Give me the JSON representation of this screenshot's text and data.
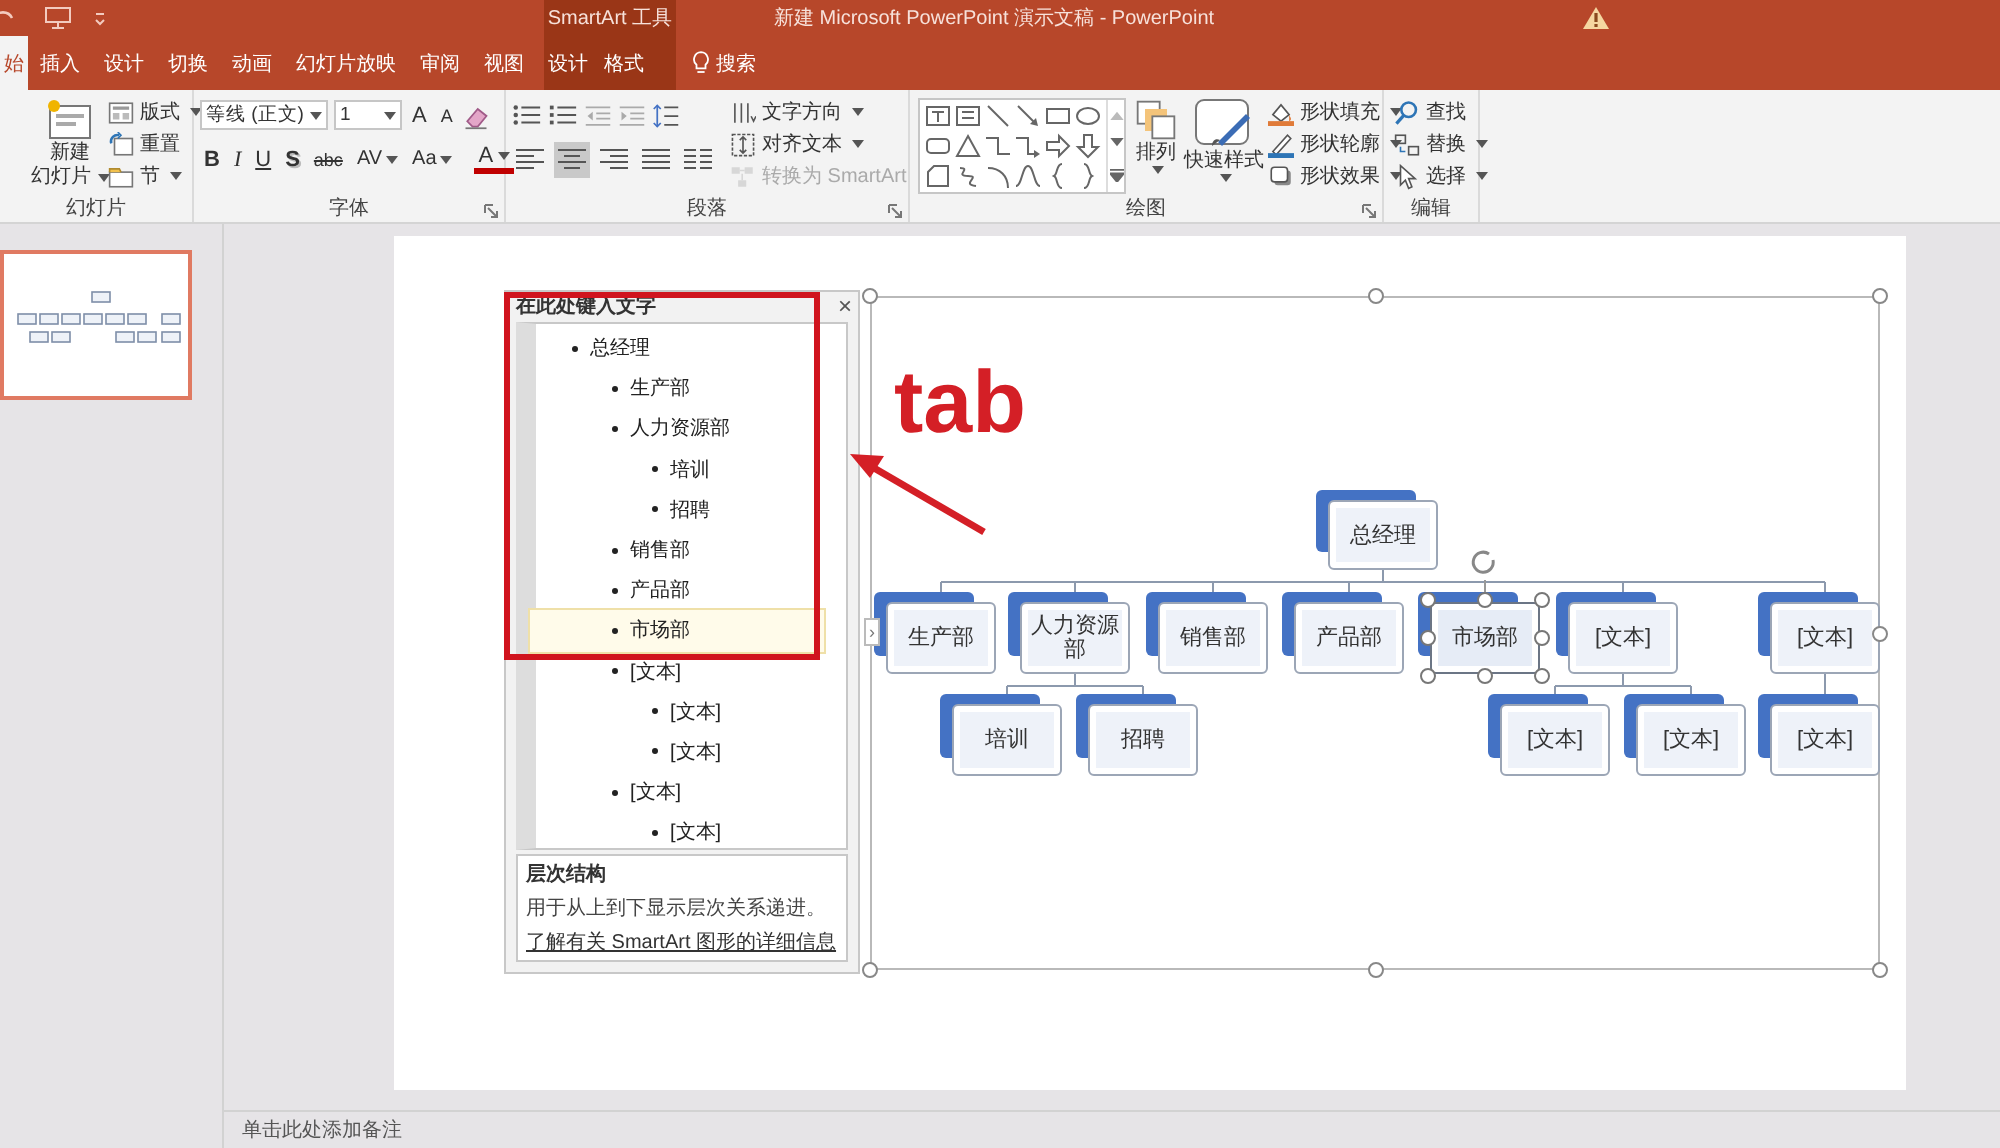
{
  "title_bar": {
    "context_label": "SmartArt 工具",
    "title": "新建 Microsoft PowerPoint 演示文稿 - PowerPoint"
  },
  "tabs": [
    {
      "label": "始",
      "selected": true,
      "kind": "main"
    },
    {
      "label": "插入",
      "selected": false,
      "kind": "main"
    },
    {
      "label": "设计",
      "selected": false,
      "kind": "main"
    },
    {
      "label": "切换",
      "selected": false,
      "kind": "main"
    },
    {
      "label": "动画",
      "selected": false,
      "kind": "main"
    },
    {
      "label": "幻灯片放映",
      "selected": false,
      "kind": "main"
    },
    {
      "label": "审阅",
      "selected": false,
      "kind": "main"
    },
    {
      "label": "视图",
      "selected": false,
      "kind": "main"
    },
    {
      "label": "设计",
      "selected": false,
      "kind": "context"
    },
    {
      "label": "格式",
      "selected": false,
      "kind": "context"
    }
  ],
  "search": {
    "label": "搜索"
  },
  "ribbon": {
    "slides": {
      "title": "幻灯片",
      "new_slide": [
        "新建",
        "幻灯片"
      ],
      "buttons": [
        "版式",
        "重置",
        "节"
      ]
    },
    "font": {
      "title": "字体",
      "font_name": "等线 (正文)",
      "font_size": "1",
      "grow": "A",
      "shrink": "A",
      "format_buttons": [
        {
          "label": "B",
          "kind": "bold"
        },
        {
          "label": "I",
          "kind": "italic"
        },
        {
          "label": "U",
          "kind": "underline"
        },
        {
          "label": "S",
          "kind": "shadow"
        },
        {
          "label": "abc",
          "kind": "strike"
        },
        {
          "label": "AV",
          "kind": "spacing"
        },
        {
          "label": "Aa",
          "kind": "case"
        },
        {
          "label": "A",
          "kind": "color"
        }
      ]
    },
    "paragraph": {
      "title": "段落",
      "text_direction": "文字方向",
      "align_text": "对齐文本",
      "convert": {
        "label": "转换为 SmartArt",
        "disabled": true
      },
      "align_buttons": [
        {
          "kind": "left",
          "selected": false
        },
        {
          "kind": "center",
          "selected": true
        },
        {
          "kind": "right",
          "selected": false
        },
        {
          "kind": "justify",
          "selected": false
        },
        {
          "kind": "columns",
          "selected": false
        }
      ]
    },
    "drawing": {
      "title": "绘图",
      "arrange": "排列",
      "quick_styles": "快速样式",
      "shape_buttons": [
        "形状填充",
        "形状轮廓",
        "形状效果"
      ]
    },
    "editing": {
      "title": "编辑",
      "buttons": [
        {
          "label": "查找",
          "kind": "find"
        },
        {
          "label": "替换",
          "kind": "replace"
        },
        {
          "label": "选择",
          "kind": "select"
        }
      ]
    }
  },
  "slide_panel": {
    "slides": [
      {
        "selected": true
      }
    ]
  },
  "text_pane": {
    "title": "在此处键入文字",
    "close": "×",
    "items": [
      {
        "label": "总经理",
        "selected": false,
        "children": [
          {
            "label": "生产部",
            "selected": false
          },
          {
            "label": "人力资源部",
            "selected": false,
            "children": [
              {
                "label": "培训",
                "selected": false
              },
              {
                "label": "招聘",
                "selected": false
              }
            ]
          },
          {
            "label": "销售部",
            "selected": false
          },
          {
            "label": "产品部",
            "selected": false
          },
          {
            "label": "市场部",
            "selected": true
          },
          {
            "label": "[文本]",
            "selected": false,
            "children": [
              {
                "label": "[文本]",
                "selected": false
              },
              {
                "label": "[文本]",
                "selected": false
              }
            ]
          },
          {
            "label": "[文本]",
            "selected": false,
            "children": [
              {
                "label": "[文本]",
                "selected": false
              }
            ]
          }
        ]
      }
    ],
    "info_title": "层次结构",
    "info_text": "用于从上到下显示层次关系递进。",
    "info_link": "了解有关 SmartArt 图形的详细信息"
  },
  "smartart": {
    "pane_toggle": "›",
    "nodes": [
      {
        "label": "总经理",
        "selected": false,
        "children": [
          {
            "label": "生产部",
            "selected": false
          },
          {
            "label": "人力资源部",
            "selected": false,
            "children": [
              {
                "label": "培训",
                "selected": false
              },
              {
                "label": "招聘",
                "selected": false
              }
            ]
          },
          {
            "label": "销售部",
            "selected": false
          },
          {
            "label": "产品部",
            "selected": false
          },
          {
            "label": "市场部",
            "selected": true
          },
          {
            "label": "[文本]",
            "selected": false,
            "children": [
              {
                "label": "[文本]",
                "selected": false
              },
              {
                "label": "[文本]",
                "selected": false
              }
            ]
          },
          {
            "label": "[文本]",
            "selected": false,
            "children": [
              {
                "label": "[文本]",
                "selected": false
              }
            ]
          }
        ]
      }
    ]
  },
  "annotation": {
    "label": "tab"
  },
  "notes": {
    "placeholder": "单击此处添加备注"
  }
}
